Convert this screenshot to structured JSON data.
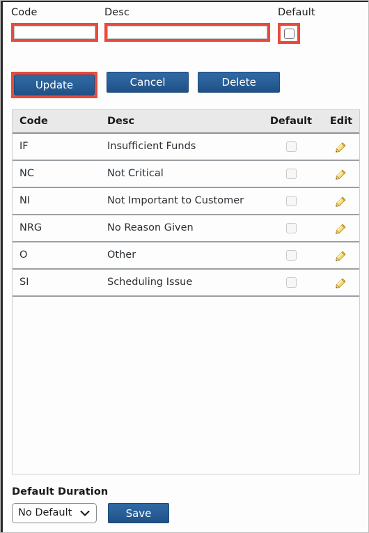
{
  "form": {
    "code": {
      "label": "Code",
      "value": "",
      "placeholder": ""
    },
    "desc": {
      "label": "Desc",
      "value": "",
      "placeholder": ""
    },
    "default": {
      "label": "Default",
      "checked": false
    }
  },
  "actions": {
    "update_label": "Update",
    "cancel_label": "Cancel",
    "delete_label": "Delete"
  },
  "grid": {
    "columns": {
      "code": "Code",
      "desc": "Desc",
      "default": "Default",
      "edit": "Edit"
    },
    "rows": [
      {
        "code": "IF",
        "desc": "Insufficient Funds",
        "default": false,
        "edit_icon": "pencil-icon"
      },
      {
        "code": "NC",
        "desc": "Not Critical",
        "default": false,
        "edit_icon": "pencil-icon"
      },
      {
        "code": "NI",
        "desc": "Not Important to Customer",
        "default": false,
        "edit_icon": "pencil-icon"
      },
      {
        "code": "NRG",
        "desc": "No Reason Given",
        "default": false,
        "edit_icon": "pencil-icon"
      },
      {
        "code": "O",
        "desc": "Other",
        "default": false,
        "edit_icon": "pencil-icon"
      },
      {
        "code": "SI",
        "desc": "Scheduling Issue",
        "default": false,
        "edit_icon": "pencil-icon"
      }
    ]
  },
  "bottom": {
    "label": "Default Duration",
    "duration_selected": "No Default",
    "duration_chevron_icon": "chevron-down-icon",
    "save_label": "Save"
  },
  "colors": {
    "button_blue": "#2a619a",
    "annotation_red": "#e84b3c",
    "header_gray": "#e9e9e9",
    "pencil_gold": "#f2cd52"
  }
}
